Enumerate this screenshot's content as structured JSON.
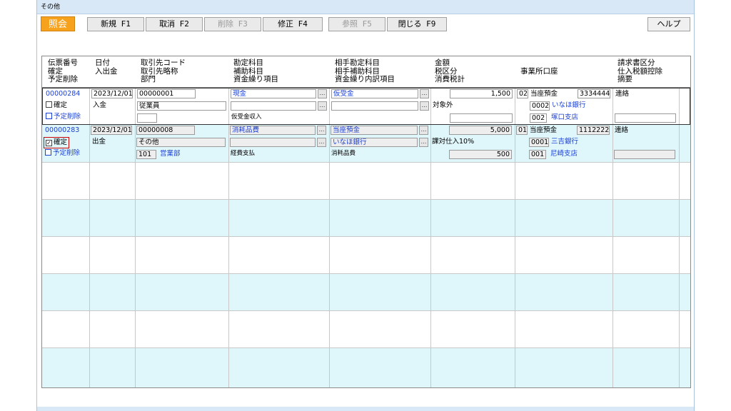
{
  "window": {
    "title": "その他"
  },
  "toolbar": {
    "mode": "照会",
    "buttons": [
      {
        "label": "新規 F1",
        "enabled": true
      },
      {
        "label": "取消 F2",
        "enabled": true
      },
      {
        "label": "削除 F3",
        "enabled": false
      },
      {
        "label": "修正 F4",
        "enabled": true
      },
      {
        "label": "参照 F5",
        "enabled": false
      },
      {
        "label": "閉じる F9",
        "enabled": true
      }
    ],
    "help": "ヘルプ"
  },
  "headers": {
    "col1": [
      "伝票番号",
      "確定",
      "予定削除"
    ],
    "col2": [
      "日付",
      "入出金"
    ],
    "col3": [
      "取引先コード",
      "取引先略称",
      "部門"
    ],
    "col4": [
      "勘定科目",
      "補助科目",
      "資金繰り項目"
    ],
    "col5": [
      "相手勘定科目",
      "相手補助科目",
      "資金繰り内訳項目"
    ],
    "col6": [
      "金額",
      "税区分",
      "消費税計"
    ],
    "col7": [
      "事業所口座"
    ],
    "col8": [
      "請求書区分",
      "仕入税額控除",
      "摘要"
    ]
  },
  "rows": [
    {
      "voucher": "00000284",
      "confirmed_label": "確定",
      "delete_label": "予定削除",
      "date": "2023/12/01",
      "io": "入金",
      "partner_code": "00000001",
      "partner_name": "従業員",
      "dept_code": "",
      "dept_name": "",
      "account": "現金",
      "sub_account": "",
      "cash_item": "仮受金収入",
      "counter_account": "仮受金",
      "counter_sub": "",
      "counter_cash_item": "",
      "amount": "1,500",
      "tax_class": "対象外",
      "tax_total": "",
      "office_no": "02",
      "office_type": "当座預金",
      "office_acct": "3334444",
      "bank_code": "0002",
      "bank_name": "いなほ銀行",
      "branch_code": "002",
      "branch_name": "塚口支店",
      "invoice": "連絡",
      "summary": ""
    },
    {
      "voucher": "00000283",
      "confirmed_label": "確定",
      "delete_label": "予定削除",
      "date": "2023/12/01",
      "io": "出金",
      "partner_code": "00000008",
      "partner_name": "その他",
      "dept_code": "101",
      "dept_name": "営業部",
      "account": "消耗品費",
      "sub_account": "",
      "cash_item": "経費支払",
      "counter_account": "当座預金",
      "counter_sub": "いなほ銀行",
      "counter_cash_item": "消耗品費",
      "amount": "5,000",
      "tax_class": "課対仕入10%",
      "tax_total": "500",
      "office_no": "01",
      "office_type": "当座預金",
      "office_acct": "1112222",
      "bank_code": "0001",
      "bank_name": "三吉銀行",
      "branch_code": "001",
      "branch_name": "尼崎支店",
      "invoice": "連絡",
      "summary": ""
    }
  ],
  "colors": {
    "accent": "#f7a21c",
    "row_alt": "#dff6fb",
    "link": "#1a3fd6",
    "highlight": "#cc0000"
  }
}
